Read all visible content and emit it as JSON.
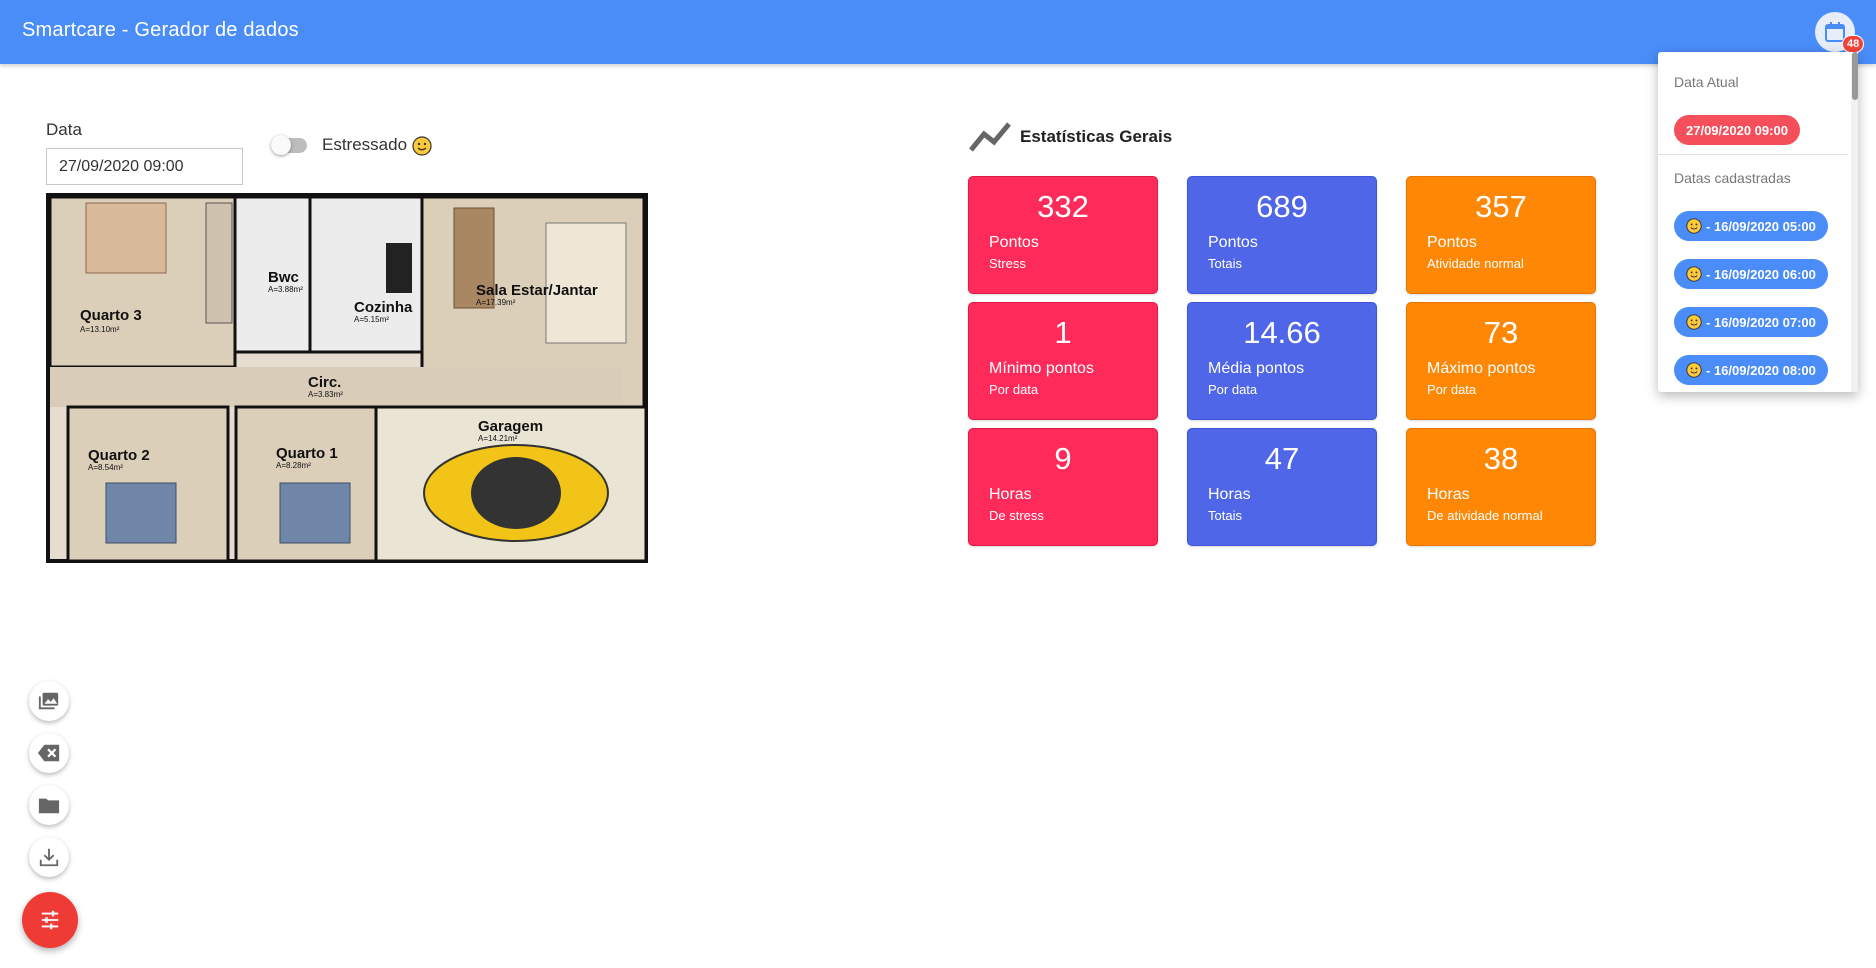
{
  "header": {
    "title": "Smartcare - Gerador de dados",
    "calendar_badge": "48"
  },
  "form": {
    "date_label": "Data",
    "date_value": "27/09/2020 09:00",
    "toggle_label": "Estressado"
  },
  "floorplan": {
    "rooms": [
      {
        "name": "Quarto 3",
        "area": "A=13.10m²"
      },
      {
        "name": "Bwc",
        "area": "A=3.88m²"
      },
      {
        "name": "Cozinha",
        "area": "A=5.15m²"
      },
      {
        "name": "Sala Estar/Jantar",
        "area": "A=17.39m²"
      },
      {
        "name": "Circ.",
        "area": "A=3.83m²"
      },
      {
        "name": "Garagem",
        "area": "A=14.21m²"
      },
      {
        "name": "Quarto 2",
        "area": "A=8.54m²"
      },
      {
        "name": "Quarto 1",
        "area": "A=8.28m²"
      }
    ]
  },
  "stats": {
    "title": "Estatísticas Gerais",
    "cards": [
      {
        "value": "332",
        "label": "Pontos",
        "sub": "Stress",
        "color": "red"
      },
      {
        "value": "689",
        "label": "Pontos",
        "sub": "Totais",
        "color": "blue"
      },
      {
        "value": "357",
        "label": "Pontos",
        "sub": "Atividade normal",
        "color": "orange"
      },
      {
        "value": "1",
        "label": "Mínimo pontos",
        "sub": "Por data",
        "color": "red"
      },
      {
        "value": "14.66",
        "label": "Média pontos",
        "sub": "Por data",
        "color": "blue"
      },
      {
        "value": "73",
        "label": "Máximo pontos",
        "sub": "Por data",
        "color": "orange"
      },
      {
        "value": "9",
        "label": "Horas",
        "sub": "De stress",
        "color": "red"
      },
      {
        "value": "47",
        "label": "Horas",
        "sub": "Totais",
        "color": "blue"
      },
      {
        "value": "38",
        "label": "Horas",
        "sub": "De atividade normal",
        "color": "orange"
      }
    ]
  },
  "dropdown": {
    "current_heading": "Data Atual",
    "current_date": "27/09/2020 09:00",
    "registered_heading": "Datas cadastradas",
    "registered": [
      "- 16/09/2020 05:00",
      "- 16/09/2020 06:00",
      "- 16/09/2020 07:00",
      "- 16/09/2020 08:00"
    ]
  },
  "fab": {
    "actions": [
      "gallery-icon",
      "backspace-icon",
      "folder-icon",
      "download-icon"
    ],
    "main": "tune-icon"
  },
  "colors": {
    "appbar": "#4a8cf8",
    "red": "#fe2b5a",
    "blue": "#5066e8",
    "orange": "#ff8706",
    "fab": "#ef3b36"
  }
}
